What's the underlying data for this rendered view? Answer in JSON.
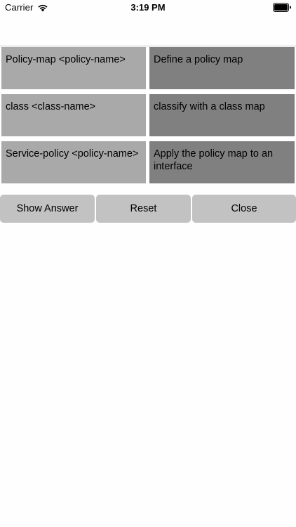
{
  "status_bar": {
    "carrier": "Carrier",
    "time": "3:19 PM",
    "wifi_icon": "wifi-icon",
    "battery_icon": "battery-icon"
  },
  "matches": [
    {
      "term": "Policy-map <policy-name>",
      "definition": "Define a policy map"
    },
    {
      "term": "class <class-name>",
      "definition": "classify with a class map"
    },
    {
      "term": "Service-policy <policy-name>",
      "definition": "Apply the policy map to an interface"
    }
  ],
  "buttons": {
    "show_answer": "Show Answer",
    "reset": "Reset",
    "close": "Close"
  },
  "colors": {
    "term_cell": "#a9a9a9",
    "definition_cell": "#808080",
    "button": "#c2c2c2"
  }
}
